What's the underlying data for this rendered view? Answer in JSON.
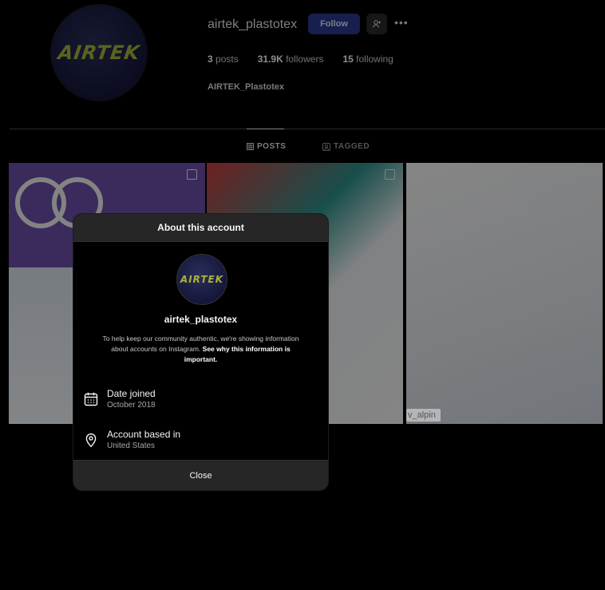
{
  "profile": {
    "username": "airtek_plastotex",
    "follow_label": "Follow",
    "more_label": "•••",
    "logo_text": "AIRTEK",
    "full_name": "AIRTEK_Plastotex",
    "stats": {
      "posts_count": "3",
      "posts_label": "posts",
      "followers_count": "31.9K",
      "followers_label": "followers",
      "following_count": "15",
      "following_label": "following"
    }
  },
  "tabs": {
    "posts_label": "POSTS",
    "tagged_label": "TAGGED"
  },
  "grid": {
    "tile3_caption": "v_alpin"
  },
  "modal": {
    "title": "About this account",
    "logo_text": "AIRTEK",
    "username": "airtek_plastotex",
    "info_text": "To help keep our community authentic, we're showing information about accounts on Instagram.",
    "info_link": "See why this information is important.",
    "date_joined_label": "Date joined",
    "date_joined_value": "October 2018",
    "based_in_label": "Account based in",
    "based_in_value": "United States",
    "close_label": "Close"
  },
  "colors": {
    "follow_button": "#2b3a8f",
    "logo": "#a7b33a",
    "modal_header": "#262626"
  }
}
